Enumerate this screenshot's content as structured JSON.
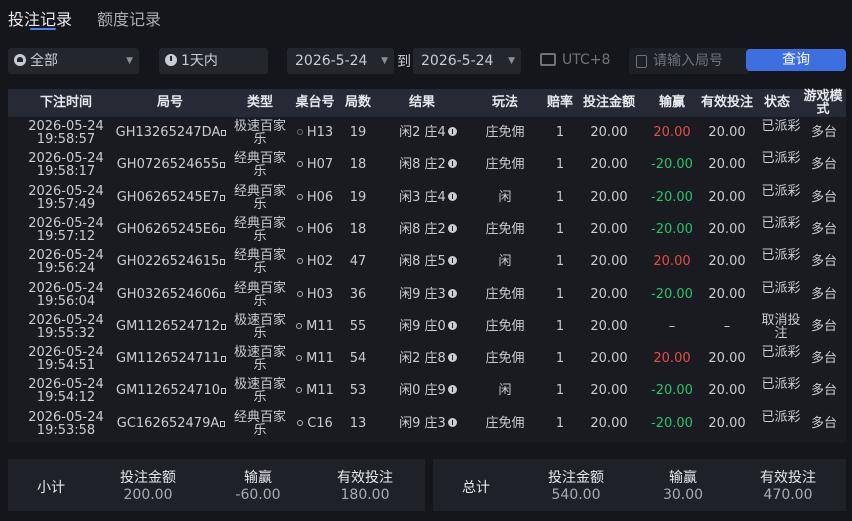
{
  "tabs": {
    "active": "投注记录",
    "other": "额度记录"
  },
  "filters": {
    "game": "全部",
    "period": "1天内",
    "date_from": "2026-5-24",
    "to_label": "到",
    "date_to": "2026-5-24",
    "timezone": "UTC+8",
    "search_placeholder": "请输入局号",
    "query_button": "查询"
  },
  "table": {
    "headers": [
      "下注时间",
      "局号",
      "类型",
      "桌台号",
      "局数",
      "结果",
      "玩法",
      "赔率",
      "投注金额",
      "输赢",
      "有效投注",
      "状态",
      "游戏模式"
    ],
    "rows": [
      {
        "date": "2026-05-24",
        "time": "19:58:57",
        "id": "GH13265247DA",
        "type": "极速百家乐",
        "table": "H13",
        "round": "19",
        "result": "闲2 庄4",
        "play": "庄免佣",
        "odds": "1",
        "bet": "20.00",
        "win": "20.00",
        "win_color": "red",
        "valid": "20.00",
        "status": "已派彩",
        "mode": "多台",
        "faint_dot": true
      },
      {
        "date": "2026-05-24",
        "time": "19:58:17",
        "id": "GH0726524655",
        "type": "经典百家乐",
        "table": "H07",
        "round": "18",
        "result": "闲8 庄2",
        "play": "庄免佣",
        "odds": "1",
        "bet": "20.00",
        "win": "-20.00",
        "win_color": "green",
        "valid": "20.00",
        "status": "已派彩",
        "mode": "多台",
        "faint_dot": false
      },
      {
        "date": "2026-05-24",
        "time": "19:57:49",
        "id": "GH06265245E7",
        "type": "经典百家乐",
        "table": "H06",
        "round": "19",
        "result": "闲3 庄4",
        "play": "闲",
        "odds": "1",
        "bet": "20.00",
        "win": "-20.00",
        "win_color": "green",
        "valid": "20.00",
        "status": "已派彩",
        "mode": "多台",
        "faint_dot": false
      },
      {
        "date": "2026-05-24",
        "time": "19:57:12",
        "id": "GH06265245E6",
        "type": "经典百家乐",
        "table": "H06",
        "round": "18",
        "result": "闲8 庄2",
        "play": "庄免佣",
        "odds": "1",
        "bet": "20.00",
        "win": "-20.00",
        "win_color": "green",
        "valid": "20.00",
        "status": "已派彩",
        "mode": "多台",
        "faint_dot": false
      },
      {
        "date": "2026-05-24",
        "time": "19:56:24",
        "id": "GH0226524615",
        "type": "经典百家乐",
        "table": "H02",
        "round": "47",
        "result": "闲8 庄5",
        "play": "闲",
        "odds": "1",
        "bet": "20.00",
        "win": "20.00",
        "win_color": "red",
        "valid": "20.00",
        "status": "已派彩",
        "mode": "多台",
        "faint_dot": false
      },
      {
        "date": "2026-05-24",
        "time": "19:56:04",
        "id": "GH0326524606",
        "type": "经典百家乐",
        "table": "H03",
        "round": "36",
        "result": "闲9 庄3",
        "play": "庄免佣",
        "odds": "1",
        "bet": "20.00",
        "win": "-20.00",
        "win_color": "green",
        "valid": "20.00",
        "status": "已派彩",
        "mode": "多台",
        "faint_dot": false
      },
      {
        "date": "2026-05-24",
        "time": "19:55:32",
        "id": "GM1126524712",
        "type": "极速百家乐",
        "table": "M11",
        "round": "55",
        "result": "闲9 庄0",
        "play": "庄免佣",
        "odds": "1",
        "bet": "20.00",
        "win": "–",
        "win_color": "plain",
        "valid": "–",
        "status": "取消投注",
        "mode": "多台",
        "faint_dot": false
      },
      {
        "date": "2026-05-24",
        "time": "19:54:51",
        "id": "GM1126524711",
        "type": "极速百家乐",
        "table": "M11",
        "round": "54",
        "result": "闲2 庄8",
        "play": "庄免佣",
        "odds": "1",
        "bet": "20.00",
        "win": "20.00",
        "win_color": "red",
        "valid": "20.00",
        "status": "已派彩",
        "mode": "多台",
        "faint_dot": false
      },
      {
        "date": "2026-05-24",
        "time": "19:54:12",
        "id": "GM1126524710",
        "type": "极速百家乐",
        "table": "M11",
        "round": "53",
        "result": "闲0 庄9",
        "play": "闲",
        "odds": "1",
        "bet": "20.00",
        "win": "-20.00",
        "win_color": "green",
        "valid": "20.00",
        "status": "已派彩",
        "mode": "多台",
        "faint_dot": false
      },
      {
        "date": "2026-05-24",
        "time": "19:53:58",
        "id": "GC162652479A",
        "type": "经典百家乐",
        "table": "C16",
        "round": "13",
        "result": "闲9 庄3",
        "play": "庄免佣",
        "odds": "1",
        "bet": "20.00",
        "win": "-20.00",
        "win_color": "green",
        "valid": "20.00",
        "status": "已派彩",
        "mode": "多台",
        "faint_dot": false
      }
    ]
  },
  "summary": {
    "subtotal": {
      "title": "小计",
      "bet_label": "投注金额",
      "bet": "200.00",
      "win_label": "输赢",
      "win": "-60.00",
      "win_color": "green",
      "valid_label": "有效投注",
      "valid": "180.00"
    },
    "total": {
      "title": "总计",
      "bet_label": "投注金额",
      "bet": "540.00",
      "win_label": "输赢",
      "win": "30.00",
      "win_color": "red",
      "valid_label": "有效投注",
      "valid": "470.00"
    }
  },
  "colors": {
    "accent": "#3d6fe0",
    "win": "#e84a4a",
    "loss": "#28c46c"
  },
  "icons": [
    "globe-icon",
    "clock-icon",
    "calendar-icon",
    "document-icon",
    "info-icon",
    "copy-icon",
    "status-dot-icon"
  ]
}
